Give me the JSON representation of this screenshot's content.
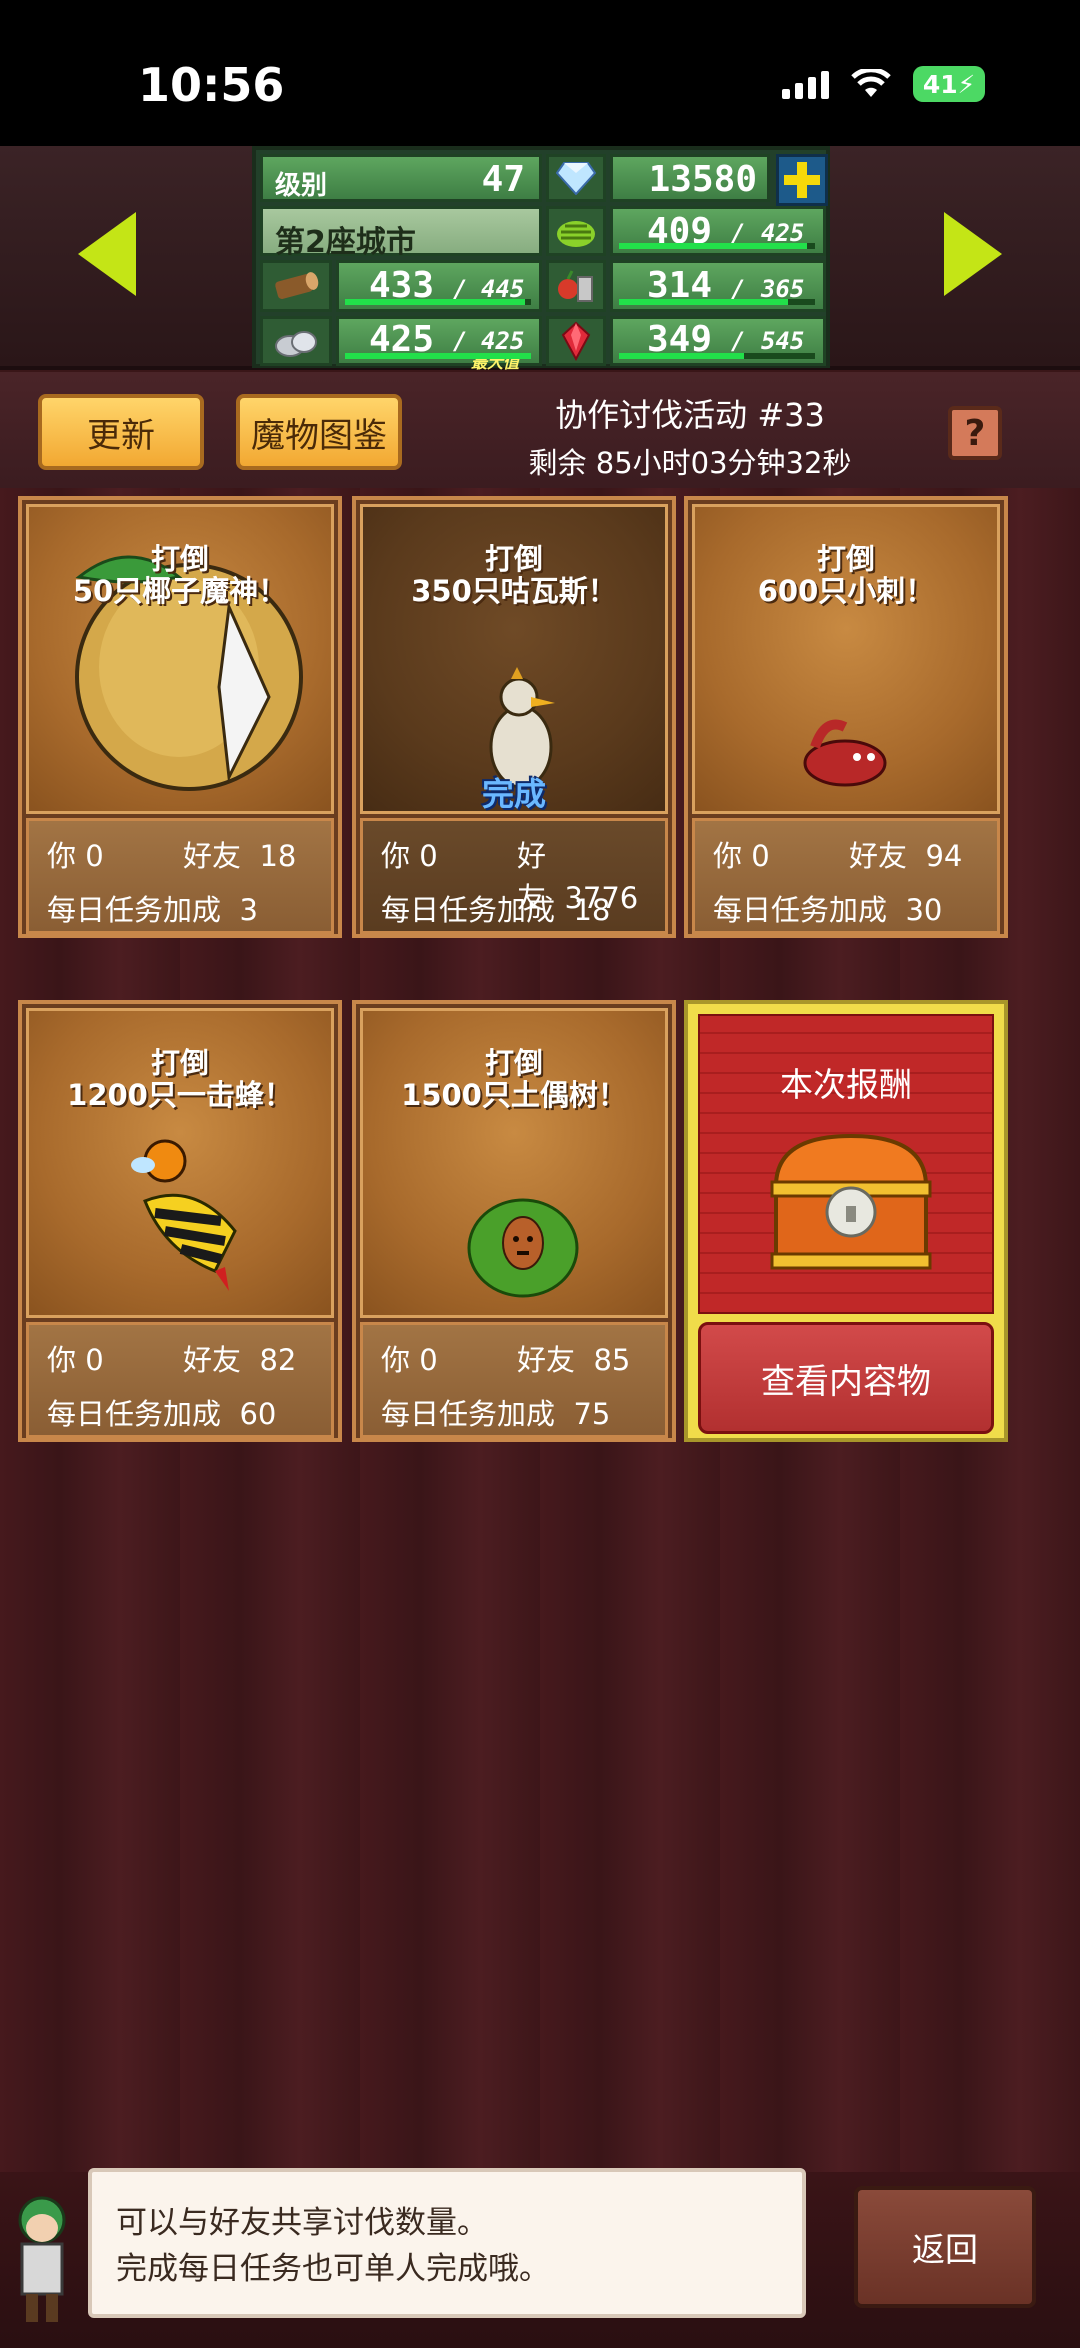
{
  "status_bar": {
    "time": "10:56",
    "battery": "41"
  },
  "header": {
    "level_label": "级别",
    "level_value": "47",
    "diamonds": "13580",
    "city_name": "第2座城市",
    "resources": [
      {
        "icon": "wood-log-icon",
        "value": "433",
        "max": "445",
        "fill": 0.97
      },
      {
        "icon": "stone-icon",
        "value": "425",
        "max": "425",
        "fill": 1.0,
        "note": "最大值"
      },
      {
        "icon": "grass-icon",
        "value": "409",
        "max": "425",
        "fill": 0.96
      },
      {
        "icon": "food-icon",
        "value": "314",
        "max": "365",
        "fill": 0.86
      },
      {
        "icon": "ruby-icon",
        "value": "349",
        "max": "545",
        "fill": 0.64
      }
    ]
  },
  "toolbar": {
    "refresh_label": "更新",
    "monster_guide_label": "魔物图鉴",
    "event_title": "协作讨伐活动 #33",
    "event_remaining": "剩余 85小时03分钟32秒",
    "help_label": "?"
  },
  "cards": [
    {
      "title_line1": "打倒",
      "title_line2": "50只椰子魔神！",
      "you": "你 0",
      "friends_label": "好友",
      "friends": "18",
      "daily_label": "每日任务加成",
      "daily": "3",
      "done": false
    },
    {
      "title_line1": "打倒",
      "title_line2": "350只咕瓦斯！",
      "you": "你 0",
      "friends_label": "好友",
      "friends": "3776",
      "daily_label": "每日任务加成",
      "daily": "18",
      "done": true,
      "done_label": "完成"
    },
    {
      "title_line1": "打倒",
      "title_line2": "600只小刺！",
      "you": "你 0",
      "friends_label": "好友",
      "friends": "94",
      "daily_label": "每日任务加成",
      "daily": "30",
      "done": false
    },
    {
      "title_line1": "打倒",
      "title_line2": "1200只一击蜂！",
      "you": "你 0",
      "friends_label": "好友",
      "friends": "82",
      "daily_label": "每日任务加成",
      "daily": "60",
      "done": false
    },
    {
      "title_line1": "打倒",
      "title_line2": "1500只土偶树！",
      "you": "你 0",
      "friends_label": "好友",
      "friends": "85",
      "daily_label": "每日任务加成",
      "daily": "75",
      "done": false
    }
  ],
  "reward": {
    "title": "本次报酬",
    "view_label": "查看内容物"
  },
  "dialog": {
    "line1": "可以与好友共享讨伐数量。",
    "line2": "完成每日任务也可单人完成哦。"
  },
  "back_label": "返回",
  "colors": {
    "accent": "#c4e516",
    "button_yellow": "#f2a832",
    "reward_red": "#c02828"
  }
}
